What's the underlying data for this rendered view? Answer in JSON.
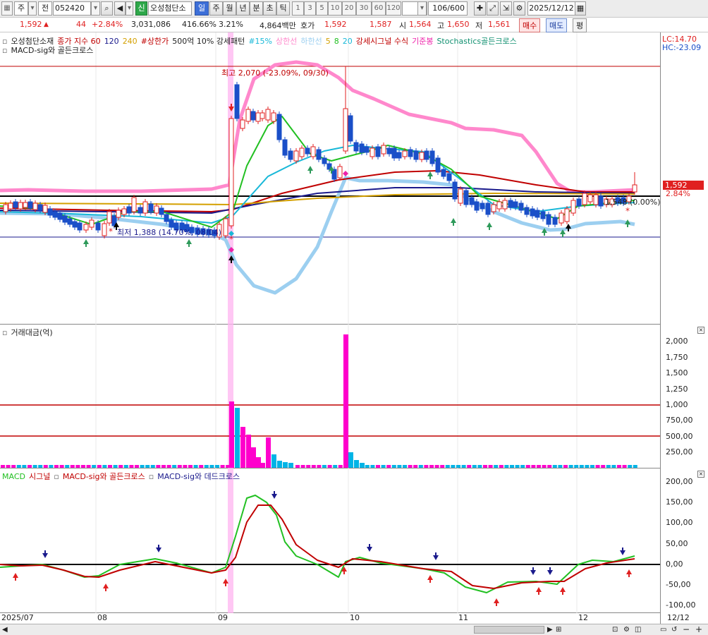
{
  "toolbar": {
    "market_sel": "주",
    "dir_sel": "전",
    "code": "052420",
    "badge_new": "신",
    "stock_name": "오성첨단소",
    "periods": [
      "일",
      "주",
      "월",
      "년",
      "분",
      "초",
      "틱"
    ],
    "minutes": [
      "1",
      "3",
      "5",
      "10",
      "20",
      "30",
      "60",
      "120"
    ],
    "count": "106/600",
    "date": "2025/12/12"
  },
  "info": {
    "price": "1,592",
    "change": "44",
    "change_pct": "+2.84%",
    "volume": "3,031,086",
    "vol_ratio": "416.66%",
    "turnover": "3.21%",
    "amount": "4,864백만",
    "hoga_label": "호가",
    "ask": "1,592",
    "bid": "1,587",
    "open_label": "시",
    "open": "1,564",
    "high_label": "고",
    "high": "1,650",
    "low_label": "저",
    "low": "1,561",
    "buy_btn": "매수",
    "sell_btn": "매도",
    "avg_btn": "평"
  },
  "price_legend": {
    "name": "오성첨단소재",
    "items": [
      {
        "text": "종가 지수 60",
        "color": "#c00000"
      },
      {
        "text": "120",
        "color": "#1a1a8c"
      },
      {
        "text": "240",
        "color": "#d4a000"
      },
      {
        "text": "#상한가",
        "color": "#c00000"
      },
      {
        "text": "500억 10% 강세패턴",
        "color": "#222222"
      },
      {
        "text": "#15%",
        "color": "#18b8d8"
      },
      {
        "text": "상한선",
        "color": "#ff88cc"
      },
      {
        "text": "하한선",
        "color": "#9ccff0"
      },
      {
        "text": "5",
        "color": "#d4a000"
      },
      {
        "text": "8",
        "color": "#22c022"
      },
      {
        "text": "20",
        "color": "#18b8d8"
      },
      {
        "text": "강세시그널 수식",
        "color": "#c00000"
      },
      {
        "text": "기준봉",
        "color": "#ee22aa"
      },
      {
        "text": "Stochastics골든크로스",
        "color": "#109070"
      }
    ],
    "macd_line": "MACD-sig와 골든크로스",
    "lc": "LC:14.70",
    "hc": "HC:-23.09"
  },
  "annotations": {
    "high": "최고 2,070 (-23.09%, 09/30)",
    "low": "최저 1,388 (14.70%, 08/04)",
    "last": "1,548 (0.00%)",
    "price_tag": "1,592",
    "price_tag_pct": "2.84%"
  },
  "volume_legend": "거래대금(억)",
  "macd_legend": {
    "macd": "MACD",
    "signal": "시그널",
    "golden": "MACD-sig와 골든크로스",
    "dead": "MACD-sig와 데드크로스"
  },
  "volume_axis": [
    "2,000",
    "1,750",
    "1,500",
    "1,250",
    "1,000",
    "750,00",
    "500,00",
    "250,00"
  ],
  "macd_axis": [
    "200,00",
    "150,00",
    "100,00",
    "50,00",
    "0,00",
    "-50,00",
    "-100,00"
  ],
  "x_axis": [
    "2025/07",
    "08",
    "09",
    "10",
    "11",
    "12",
    "12/12"
  ],
  "colors": {
    "up": "#e02020",
    "down": "#1a4fc8",
    "vol_high": "#ff00cc",
    "vol_low": "#00b4e6"
  }
}
